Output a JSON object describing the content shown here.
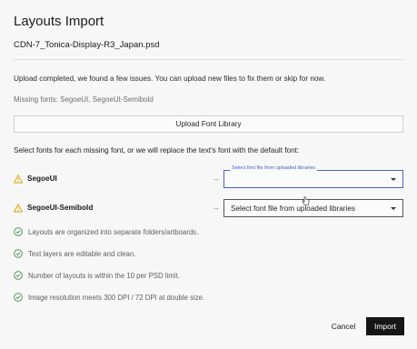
{
  "dialog": {
    "title": "Layouts Import",
    "filename": "CDN-7_Tonica-Display-R3_Japan.psd",
    "notice": "Upload completed, we found a few issues. You can upload new files to fix them or skip for now.",
    "missing_fonts": "Missing fonts: SegoeUI, SegoeUI-Semibold",
    "upload_button": "Upload Font Library",
    "select_intro": "Select fonts for each missing font, or we will replace the text's font with the default font:"
  },
  "fonts": [
    {
      "name": "SegoeUI",
      "select_label": "Select font file from uploaded libraries",
      "select_value": ""
    },
    {
      "name": "SegoeUI-Semibold",
      "select_value": "Select font file from uploaded libraries"
    }
  ],
  "checks": [
    "Layouts are organized into separate folders/artboards.",
    "Text layers are editable and clean.",
    "Number of layouts is within the 10 per PSD limit.",
    "Image resolution meets 300 DPI / 72 DPI at double size."
  ],
  "footer": {
    "cancel": "Cancel",
    "import": "Import"
  },
  "colors": {
    "accent": "#4a62c9",
    "warning": "#d6a300",
    "success": "#3c8a48",
    "primary_button": "#161616"
  },
  "icons": {
    "warning": "warning-icon",
    "check": "check-circle-icon",
    "arrow": "arrow-right-icon",
    "caret": "chevron-down-icon"
  }
}
